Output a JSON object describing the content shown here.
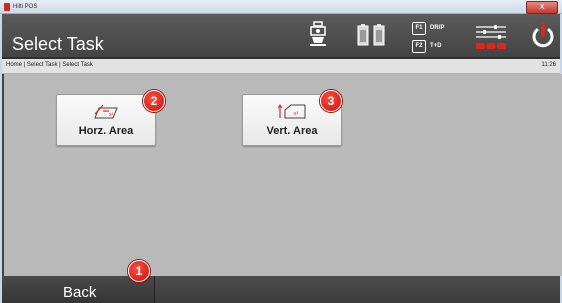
{
  "window": {
    "title": "Hilti POS",
    "close_glyph": "x"
  },
  "header": {
    "title": "Select Task",
    "icons": [
      "instrument-icon",
      "battery-icon",
      "battery-icon",
      "settings-sliders-icon",
      "power-icon"
    ],
    "f1_key": "F1",
    "f1_label": "DR/P",
    "f2_key": "F2",
    "f2_label": "T+D"
  },
  "breadcrumb": "Home | Select Task | Select Task",
  "clock": "11:26",
  "tasks": [
    {
      "label": "Horz. Area",
      "icon": "horizontal-area-icon",
      "callout": "2"
    },
    {
      "label": "Vert. Area",
      "icon": "vertical-area-icon",
      "callout": "3"
    }
  ],
  "footer": {
    "back_label": "Back",
    "callout": "1"
  },
  "colors": {
    "accent_red": "#e0261b",
    "header_bg": "#4f4f4f",
    "content_bg": "#b9b9b9"
  }
}
